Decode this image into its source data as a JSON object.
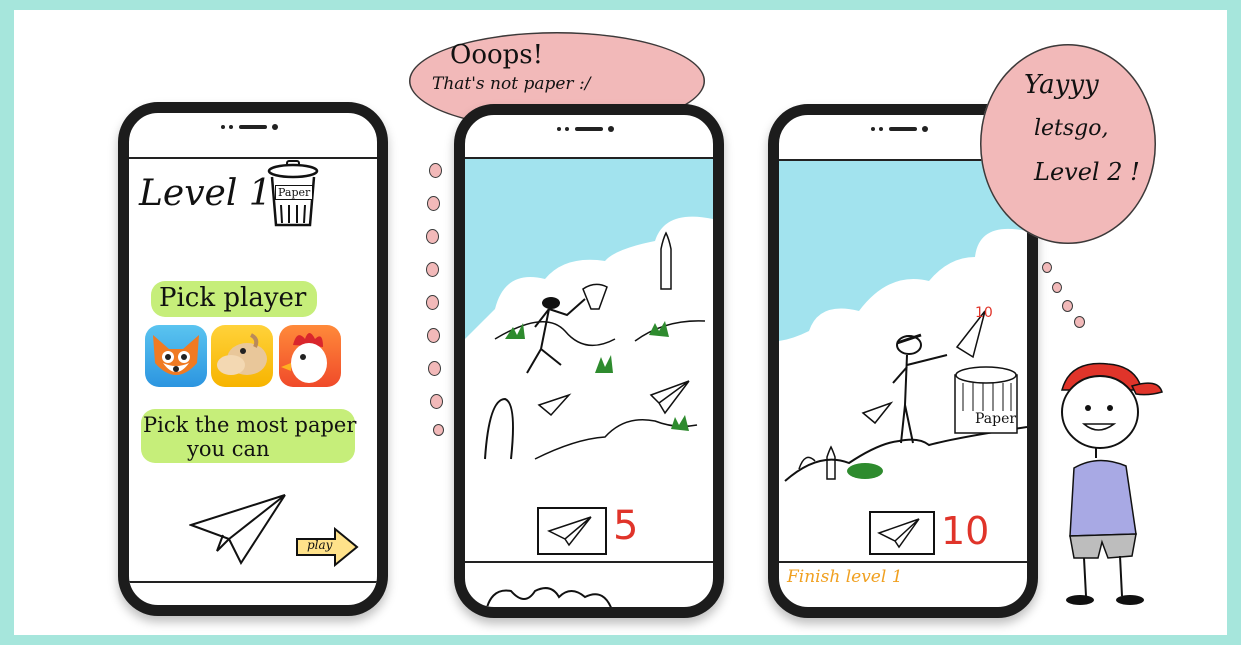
{
  "phone1": {
    "level_label": "Level 1 -",
    "bin_label": "Paper",
    "pick_player": "Pick player",
    "instruction_line1": "Pick the most paper",
    "instruction_line2": "you can",
    "play_button": "play",
    "characters": [
      "fox-icon",
      "camel-icon",
      "rooster-icon"
    ]
  },
  "phone2": {
    "bubble_line1": "Ooops!",
    "bubble_line2": "That's not paper :/",
    "score": "5"
  },
  "phone3": {
    "bubble_line1": "Yayyy",
    "bubble_line2": "letsgo,",
    "bubble_line3": "Level 2 !",
    "score": "10",
    "paper_sign": "Paper",
    "floating_score": "10",
    "finish_text": "Finish level 1"
  },
  "colors": {
    "background": "#a6e6dc",
    "sky": "#a2e3ee",
    "bubble": "#f2b9b9",
    "highlight": "#c6ee7a",
    "score_red": "#e0342a",
    "finish_orange": "#f0a020"
  }
}
